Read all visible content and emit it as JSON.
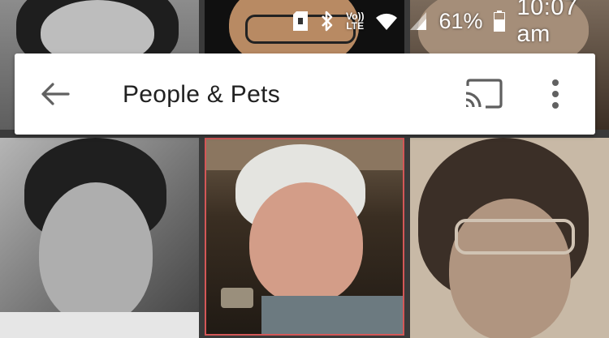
{
  "status_bar": {
    "volte_line1": "Vo))",
    "volte_line2": "LTE",
    "battery_percent": "61%",
    "battery_level": 0.61,
    "time": "10:07 am",
    "icons": [
      "sd-card-icon",
      "bluetooth-icon",
      "volte-icon",
      "wifi-icon",
      "signal-icon",
      "battery-icon"
    ]
  },
  "app_bar": {
    "back_icon": "arrow-back-icon",
    "title": "People & Pets",
    "cast_icon": "cast-icon",
    "more_icon": "more-vert-icon"
  },
  "colors": {
    "app_bar_bg": "#ffffff",
    "title_text": "#212121",
    "selected_border": "#d35757"
  }
}
